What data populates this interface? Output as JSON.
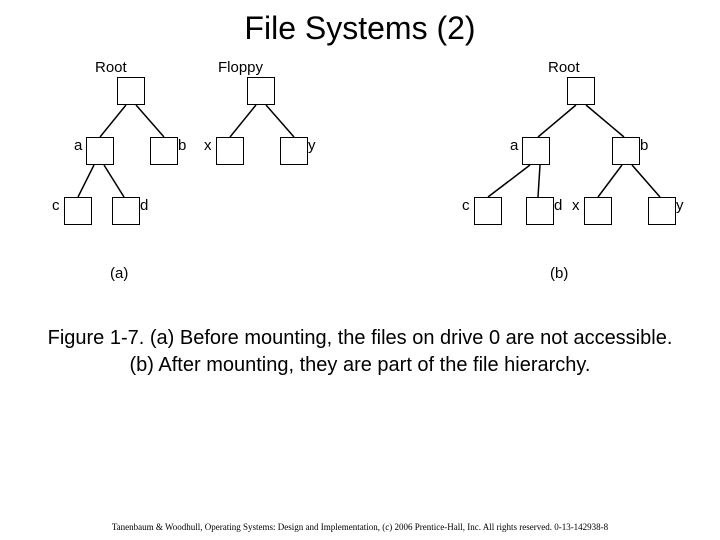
{
  "title": "File Systems (2)",
  "diagram": {
    "a": {
      "root_label": "Root",
      "floppy_label": "Floppy",
      "labels": {
        "a": "a",
        "b": "b",
        "c": "c",
        "d": "d",
        "x": "x",
        "y": "y"
      },
      "sub": "(a)"
    },
    "b": {
      "root_label": "Root",
      "labels": {
        "a": "a",
        "b": "b",
        "c": "c",
        "d": "d",
        "x": "x",
        "y": "y"
      },
      "sub": "(b)"
    }
  },
  "caption": "Figure 1-7. (a) Before mounting, the files on drive 0 are not accessible. (b) After mounting, they are part of the file hierarchy.",
  "footer": "Tanenbaum & Woodhull, Operating Systems: Design and Implementation, (c) 2006 Prentice-Hall, Inc. All rights reserved. 0-13-142938-8"
}
